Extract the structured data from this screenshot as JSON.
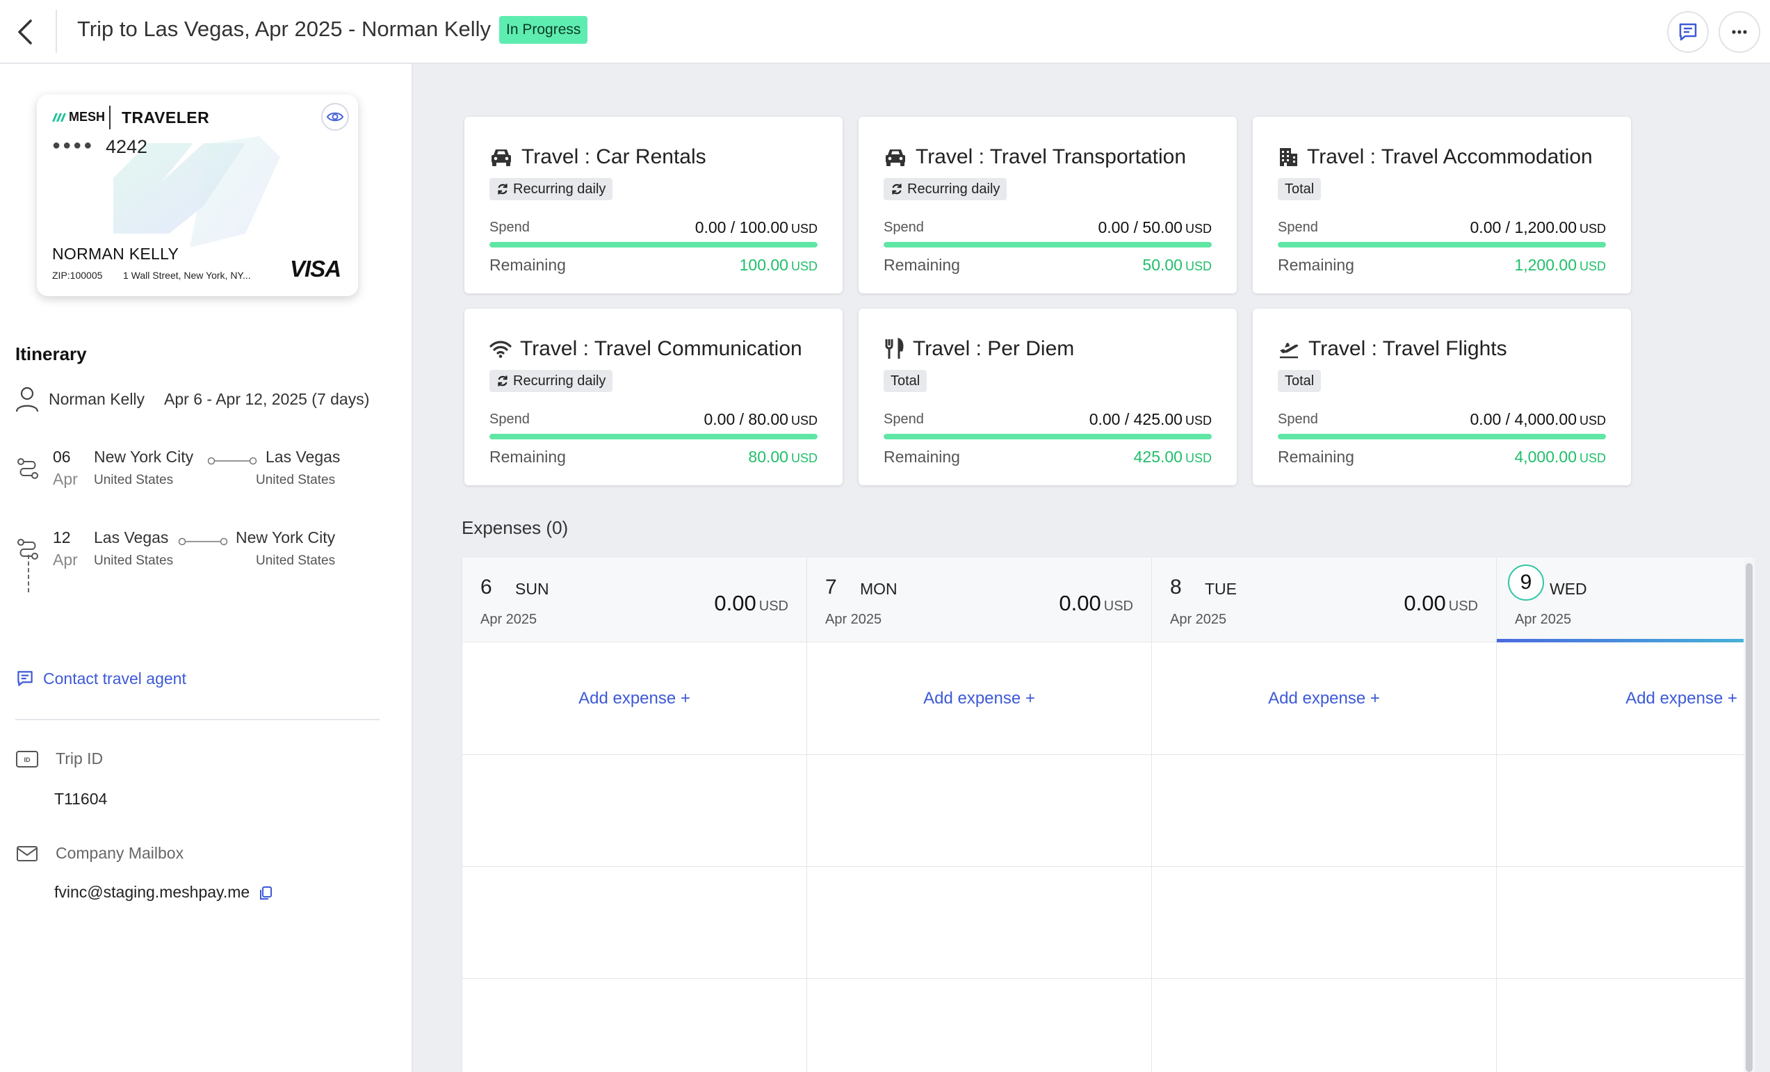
{
  "header": {
    "title": "Trip to Las Vegas, Apr 2025 - Norman Kelly",
    "status": "In Progress"
  },
  "card": {
    "brand": "MESH",
    "type": "TRAVELER",
    "dots": "●●●●",
    "last4": "4242",
    "holder": "NORMAN KELLY",
    "zip": "ZIP:100005",
    "address": "1 Wall Street, New York, NY...",
    "network": "VISA"
  },
  "itinerary": {
    "title": "Itinerary",
    "traveler": "Norman Kelly",
    "dates": "Apr 6 - Apr 12, 2025 (7 days)",
    "legs": [
      {
        "day": "06",
        "month": "Apr",
        "from": "New York City",
        "from_country": "United States",
        "to": "Las Vegas",
        "to_country": "United States"
      },
      {
        "day": "12",
        "month": "Apr",
        "from": "Las Vegas",
        "from_country": "United States",
        "to": "New York City",
        "to_country": "United States"
      }
    ],
    "contact_label": "Contact travel agent"
  },
  "trip_info": {
    "trip_id_label": "Trip ID",
    "trip_id": "T11604",
    "mailbox_label": "Company Mailbox",
    "mailbox": "fvinc@staging.meshpay.me"
  },
  "budgets": [
    {
      "title": "Travel : Car Rentals",
      "icon": "car-icon",
      "chip": "Recurring daily",
      "recurring": true,
      "spend_label": "Spend",
      "spend": "0.00 / 100.00",
      "unit": "USD",
      "remaining_label": "Remaining",
      "remaining": "100.00",
      "remaining_fraction": 1.0
    },
    {
      "title": "Travel : Travel Transportation",
      "icon": "car-icon",
      "chip": "Recurring daily",
      "recurring": true,
      "spend_label": "Spend",
      "spend": "0.00 / 50.00",
      "unit": "USD",
      "remaining_label": "Remaining",
      "remaining": "50.00",
      "remaining_fraction": 1.0
    },
    {
      "title": "Travel : Travel Accommodation",
      "icon": "building-icon",
      "chip": "Total",
      "recurring": false,
      "spend_label": "Spend",
      "spend": "0.00 / 1,200.00",
      "unit": "USD",
      "remaining_label": "Remaining",
      "remaining": "1,200.00",
      "remaining_fraction": 1.0
    },
    {
      "title": "Travel : Travel Communication",
      "icon": "wifi-icon",
      "chip": "Recurring daily",
      "recurring": true,
      "spend_label": "Spend",
      "spend": "0.00 / 80.00",
      "unit": "USD",
      "remaining_label": "Remaining",
      "remaining": "80.00",
      "remaining_fraction": 1.0
    },
    {
      "title": "Travel : Per Diem",
      "icon": "utensils-icon",
      "chip": "Total",
      "recurring": false,
      "spend_label": "Spend",
      "spend": "0.00 / 425.00",
      "unit": "USD",
      "remaining_label": "Remaining",
      "remaining": "425.00",
      "remaining_fraction": 1.0
    },
    {
      "title": "Travel : Travel Flights",
      "icon": "plane-icon",
      "chip": "Total",
      "recurring": false,
      "spend_label": "Spend",
      "spend": "0.00 / 4,000.00",
      "unit": "USD",
      "remaining_label": "Remaining",
      "remaining": "4,000.00",
      "remaining_fraction": 1.0
    }
  ],
  "expenses": {
    "title": "Expenses (0)",
    "add_label": "Add expense +",
    "days": [
      {
        "num": "6",
        "name": "SUN",
        "month_year": "Apr 2025",
        "total": "0.00",
        "unit": "USD",
        "today": false
      },
      {
        "num": "7",
        "name": "MON",
        "month_year": "Apr 2025",
        "total": "0.00",
        "unit": "USD",
        "today": false
      },
      {
        "num": "8",
        "name": "TUE",
        "month_year": "Apr 2025",
        "total": "0.00",
        "unit": "USD",
        "today": false
      },
      {
        "num": "9",
        "name": "WED",
        "month_year": "Apr 2025",
        "total": "",
        "unit": "",
        "today": true
      }
    ]
  },
  "colors": {
    "accent": "#3d5ad6",
    "status_bg": "#5eedb0",
    "progress": "#5fe6a4",
    "remaining_text": "#1fbf6a"
  }
}
